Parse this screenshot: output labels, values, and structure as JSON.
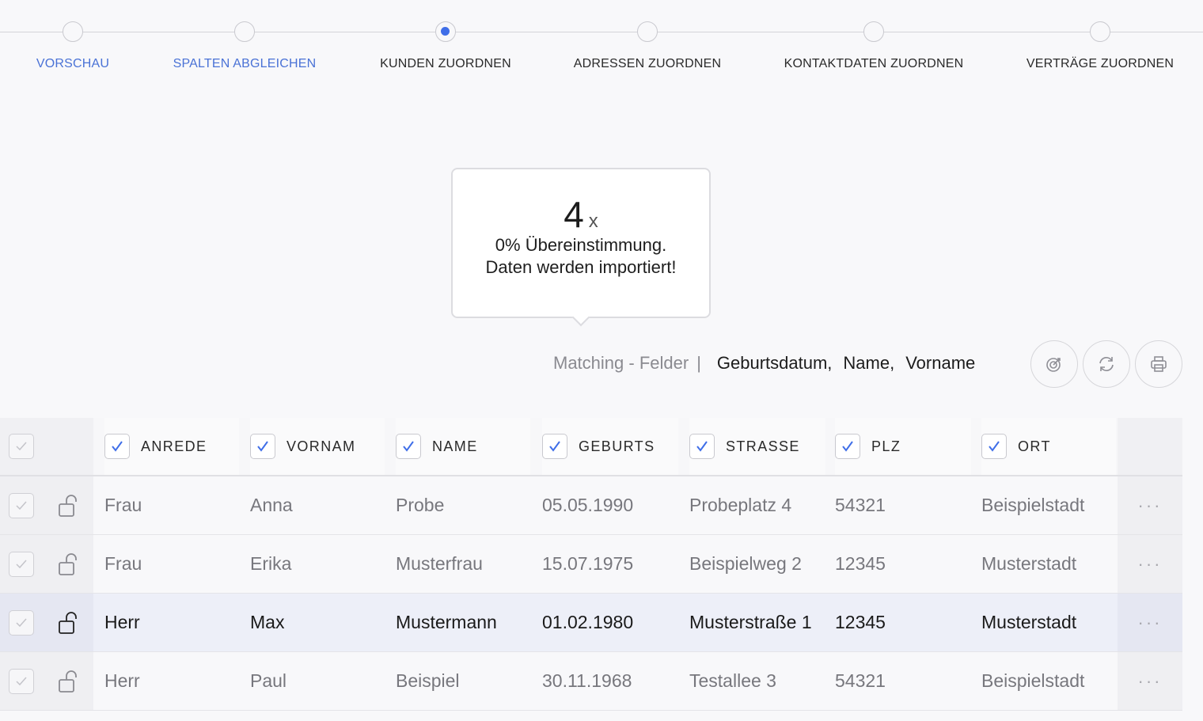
{
  "stepper": {
    "steps": [
      {
        "label": "VORSCHAU",
        "state": "done"
      },
      {
        "label": "SPALTEN ABGLEICHEN",
        "state": "done"
      },
      {
        "label": "KUNDEN ZUORDNEN",
        "state": "active"
      },
      {
        "label": "ADRESSEN ZUORDNEN",
        "state": "pending"
      },
      {
        "label": "KONTAKTDATEN ZUORDNEN",
        "state": "pending"
      },
      {
        "label": "VERTRÄGE ZUORDNEN",
        "state": "pending"
      }
    ]
  },
  "tooltip": {
    "count": "4",
    "multiplier": "x",
    "line1": "0% Übereinstimmung.",
    "line2": "Daten werden importiert!"
  },
  "matching": {
    "label": "Matching - Felder",
    "separator": "|",
    "fields": [
      "Geburtsdatum,",
      "Name,",
      "Vorname"
    ]
  },
  "toolbar": {
    "icons": [
      "target-icon",
      "refresh-icon",
      "print-icon"
    ]
  },
  "table": {
    "columns": [
      "ANREDE",
      "VORNAM",
      "NAME",
      "GEBURTS",
      "STRASSE",
      "PLZ",
      "ORT"
    ],
    "rows": [
      {
        "cells": [
          "Frau",
          "Anna",
          "Probe",
          "05.05.1990",
          "Probeplatz 4",
          "54321",
          "Beispielstadt"
        ],
        "highlight": false
      },
      {
        "cells": [
          "Frau",
          "Erika",
          "Musterfrau",
          "15.07.1975",
          "Beispielweg 2",
          "12345",
          "Musterstadt"
        ],
        "highlight": false
      },
      {
        "cells": [
          "Herr",
          "Max",
          "Mustermann",
          "01.02.1980",
          "Musterstraße 1",
          "12345",
          "Musterstadt"
        ],
        "highlight": true
      },
      {
        "cells": [
          "Herr",
          "Paul",
          "Beispiel",
          "30.11.1968",
          "Testallee 3",
          "54321",
          "Beispielstadt"
        ],
        "highlight": false
      }
    ],
    "more_label": "···"
  },
  "colors": {
    "accent": "#3f6ee8",
    "done_label": "#4a72d6",
    "muted_text": "#77777d",
    "highlight_row": "#edeff8"
  }
}
